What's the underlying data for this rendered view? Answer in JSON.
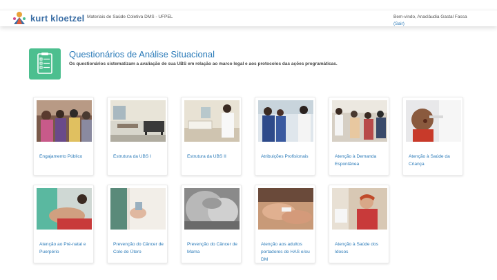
{
  "header": {
    "logo_text": "kurt kloetzel",
    "course": "Materiais de Saúde Coletiva DMS - UFPEL",
    "welcome": "Bem-vindo, Anacláudia Gastal Fassa",
    "logout": "(Sair)"
  },
  "page": {
    "title": "Questionários de Análise Situacional",
    "subtitle": "Os questionários sistematizam a avaliação de sua UBS em relação ao marco legal e aos protocolos das ações programáticas."
  },
  "cards": [
    {
      "label": "Engajamento Público"
    },
    {
      "label": "Estrutura da UBS I"
    },
    {
      "label": "Estrutura da UBS II"
    },
    {
      "label": "Atribuições Profisionais"
    },
    {
      "label": "Atenção à Demanda Espontânea"
    },
    {
      "label": "Atenção à Saúde da Criança"
    },
    {
      "label": "Atenção ao Pré-natal e Puerpério"
    },
    {
      "label": "Prevenção do Câncer de Colo de Útero"
    },
    {
      "label": "Prevenção do Câncer de Mama"
    },
    {
      "label": "Atenção aos adultos portadores de HAS e/ou DM"
    },
    {
      "label": "Atenção à Saúde dos Idosos"
    }
  ],
  "colors": {
    "accent": "#2a7ab8",
    "icon_green": "#4cbf8f"
  },
  "icons": {
    "logo": "kurt-kloetzel-logo",
    "header": "clipboard-checklist-icon"
  }
}
